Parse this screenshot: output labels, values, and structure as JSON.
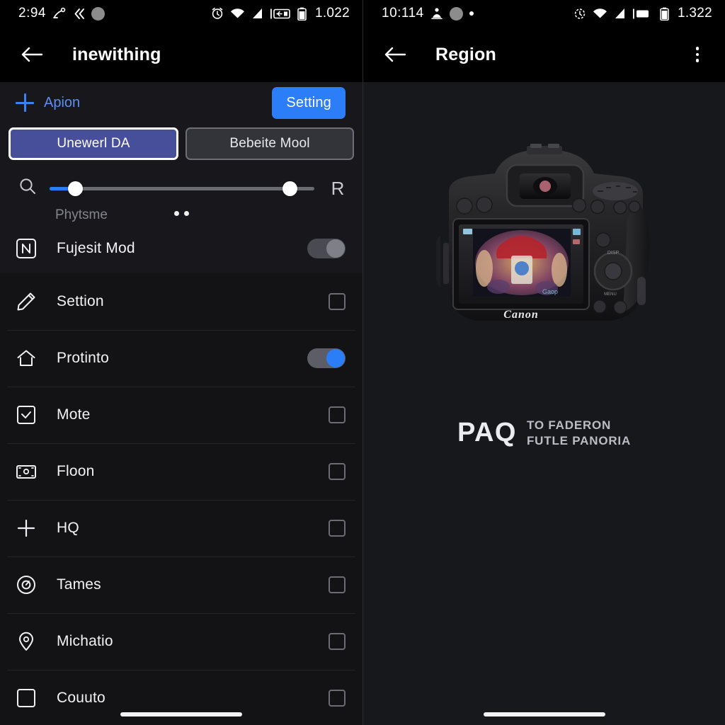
{
  "left_panel": {
    "statusbar": {
      "clock": "2:94",
      "battery_text": "1.022",
      "icons_left": [
        "cast-icon",
        "back-arrows-icon",
        "circle-blob-icon"
      ],
      "icons_right": [
        "alarm-icon",
        "wifi-icon",
        "signal-icon",
        "vibrate-icon",
        "battery-icon"
      ]
    },
    "appbar": {
      "back_icon": "back-arrow-icon",
      "title": "inewithing"
    },
    "action_row": {
      "add_icon": "plus-icon",
      "add_label": "Apion",
      "setting_label": "Setting"
    },
    "segmented": {
      "tabs": [
        {
          "label": "Unewerl DA",
          "active": true
        },
        {
          "label": "Bebeite Mool",
          "active": false
        }
      ]
    },
    "slider": {
      "left_icon": "search-icon",
      "right_icon": "R",
      "caption": "Phytsme",
      "fill_percent": 8,
      "thumb_a_percent": 7,
      "thumb_b_percent": 88,
      "dots": 2
    },
    "toggle_row": {
      "icon": "n-badge-icon",
      "label": "Fujesit Mod",
      "state": "off"
    },
    "list": [
      {
        "icon": "pen-icon",
        "label": "Settion",
        "control": "checkbox",
        "checked": false
      },
      {
        "icon": "home-icon",
        "label": "Protinto",
        "control": "switch",
        "checked": true
      },
      {
        "icon": "checkbox-icon",
        "label": "Mote",
        "control": "checkbox",
        "checked": false
      },
      {
        "icon": "card-icon",
        "label": "Floon",
        "control": "checkbox",
        "checked": false
      },
      {
        "icon": "plus-icon",
        "label": "HQ",
        "control": "checkbox",
        "checked": false
      },
      {
        "icon": "compass-icon",
        "label": "Tames",
        "control": "checkbox",
        "checked": false
      },
      {
        "icon": "pin-icon",
        "label": "Michatio",
        "control": "checkbox",
        "checked": false
      },
      {
        "icon": "square-icon",
        "label": "Couuto",
        "control": "checkbox",
        "checked": false
      }
    ],
    "home_indicator": true
  },
  "right_panel": {
    "statusbar": {
      "clock": "10:114",
      "battery_text": "1.322",
      "icons_left": [
        "person-icon",
        "circle-blob-icon",
        "dot-icon"
      ],
      "icons_right": [
        "alarm-icon",
        "wifi-icon",
        "signal-icon",
        "vibrate-icon",
        "battery-icon"
      ]
    },
    "appbar": {
      "back_icon": "back-arrow-icon",
      "title": "Region",
      "menu_icon": "kebab-menu-icon"
    },
    "hero": {
      "image_alt": "dslr-camera-rear-photo",
      "camera_brand_text": "Canon",
      "screen_label": "Gaop"
    },
    "brand": {
      "main": "PAQ",
      "sub_line1": "TO FADERON",
      "sub_line2": "FUTLE PANORIA"
    },
    "home_indicator": true
  },
  "colors": {
    "accent_blue": "#2b7ef7",
    "accent_blue_text": "#5b90f0",
    "segment_active": "#474f9b",
    "panel_bg_left": "#131316",
    "panel_bg_left_upper": "#17171c",
    "panel_bg_right": "#17181c",
    "appbar_bg": "#000000",
    "divider": "#242429"
  }
}
